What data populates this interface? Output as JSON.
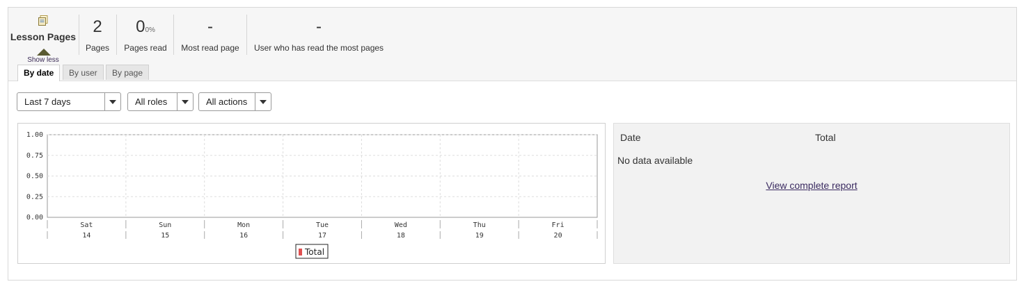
{
  "header": {
    "title": "Lesson Pages",
    "icon": "page-icon",
    "toggle_label": "Show less"
  },
  "stats": [
    {
      "value": "2",
      "suffix": "",
      "label": "Pages"
    },
    {
      "value": "0",
      "suffix": "0%",
      "label": "Pages read"
    },
    {
      "value": "-",
      "suffix": "",
      "label": "Most read page"
    },
    {
      "value": "-",
      "suffix": "",
      "label": "User who has read the most pages"
    }
  ],
  "tabs": [
    {
      "label": "By date",
      "active": true
    },
    {
      "label": "By user",
      "active": false
    },
    {
      "label": "By page",
      "active": false
    }
  ],
  "filters": {
    "period": "Last 7 days",
    "roles": "All roles",
    "actions": "All actions"
  },
  "chart_data": {
    "type": "bar",
    "categories": [
      "Sat 14",
      "Sun 15",
      "Mon 16",
      "Tue 17",
      "Wed 18",
      "Thu 19",
      "Fri 20"
    ],
    "day_names": [
      "Sat",
      "Sun",
      "Mon",
      "Tue",
      "Wed",
      "Thu",
      "Fri"
    ],
    "day_numbers": [
      "14",
      "15",
      "16",
      "17",
      "18",
      "19",
      "20"
    ],
    "series": [
      {
        "name": "Total",
        "values": [
          0,
          0,
          0,
          0,
          0,
          0,
          0
        ],
        "color": "#e05050"
      }
    ],
    "yticks": [
      "0.00",
      "0.25",
      "0.50",
      "0.75",
      "1.00"
    ],
    "ylim": [
      0,
      1
    ],
    "grid": true,
    "legend": "bottom"
  },
  "table": {
    "columns": [
      "Date",
      "Total"
    ],
    "empty_text": "No data available",
    "link_label": "View complete report"
  }
}
